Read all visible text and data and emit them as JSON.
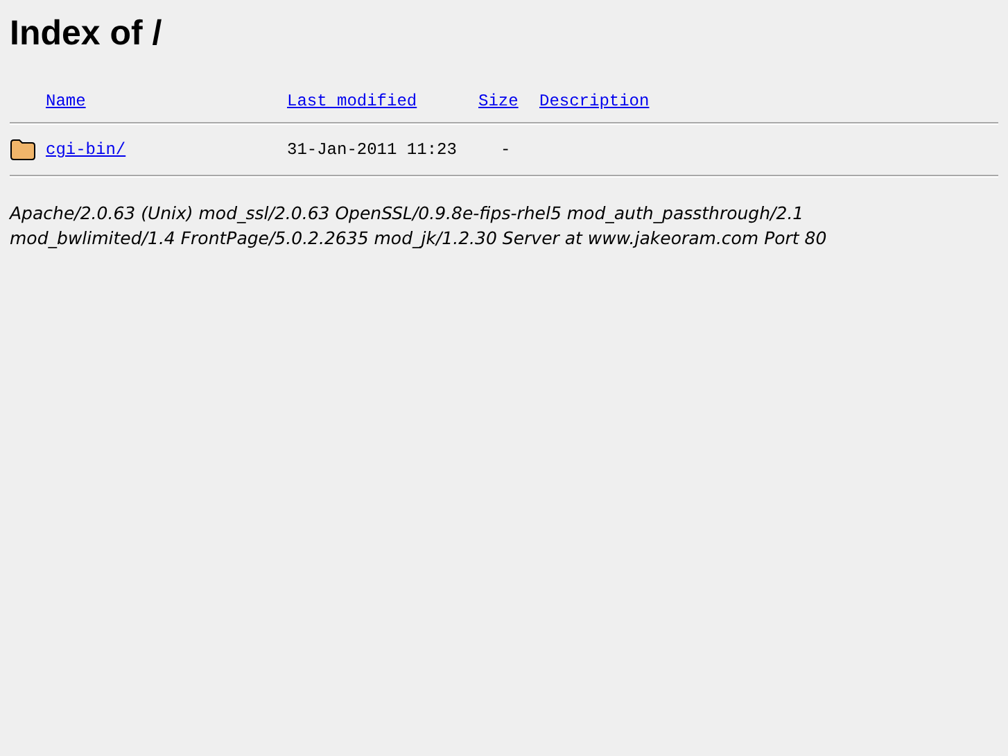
{
  "title": "Index of /",
  "columns": [
    "Name",
    "Last modified",
    "Size",
    "Description"
  ],
  "rows": [
    {
      "kind": "folder",
      "name": "cgi-bin/",
      "modified": "31-Jan-2011 11:23",
      "size": "-"
    }
  ],
  "address": "Apache/2.0.63 (Unix) mod_ssl/2.0.63 OpenSSL/0.9.8e-fips-rhel5 mod_auth_passthrough/2.1 mod_bwlimited/1.4 FrontPage/5.0.2.2635 mod_jk/1.2.30 Server at www.jakeoram.com Port 80"
}
